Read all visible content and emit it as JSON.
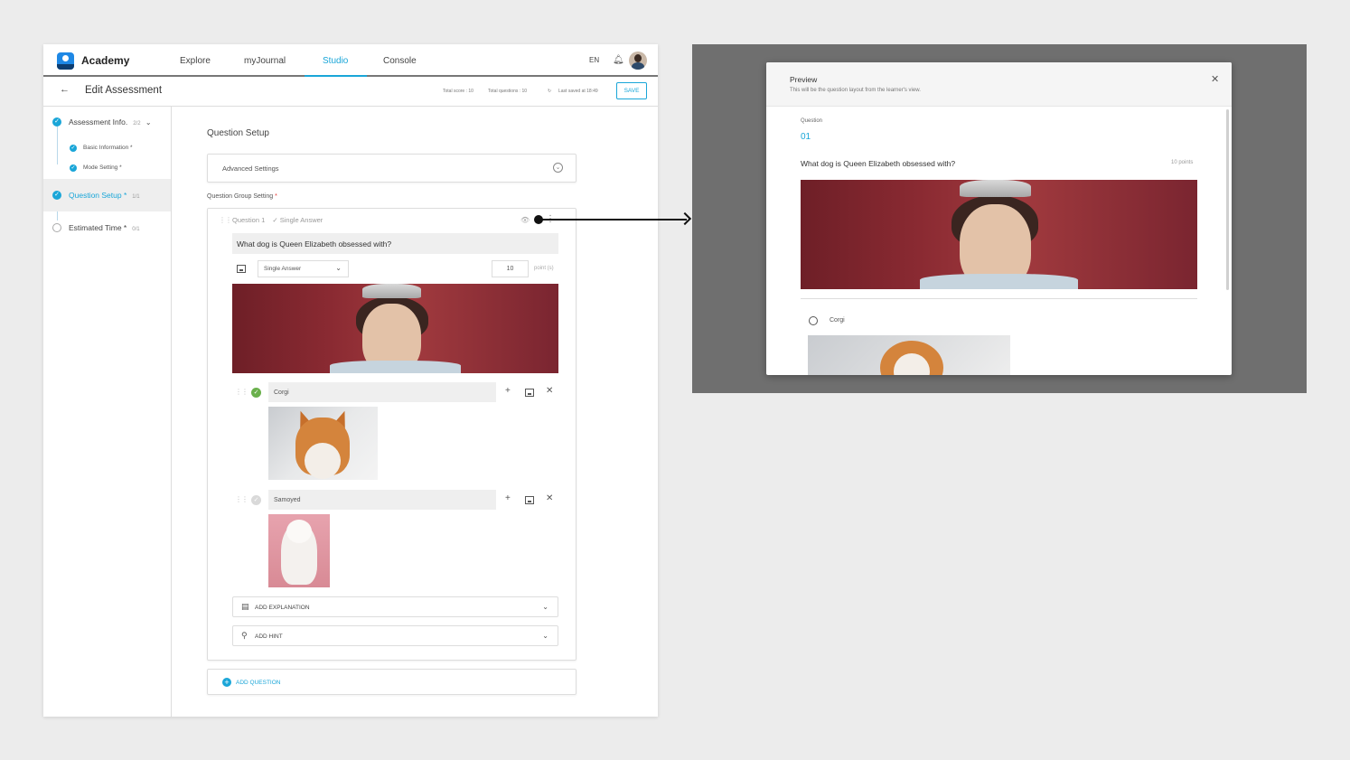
{
  "app": {
    "brand": "Academy",
    "nav": [
      "Explore",
      "myJournal",
      "Studio",
      "Console"
    ],
    "active_nav": "Studio",
    "lang": "EN"
  },
  "header": {
    "title": "Edit Assessment",
    "total_score": "Total score : 10",
    "total_questions": "Total questions : 10",
    "last_saved": "Last saved at 18:49",
    "save_label": "SAVE"
  },
  "sidebar": {
    "assessment_info": {
      "label": "Assessment Info.",
      "count": "2/2"
    },
    "basic_info": "Basic Information *",
    "mode_setting": "Mode Setting *",
    "question_setup": {
      "label": "Question Setup *",
      "count": "1/1"
    },
    "estimated_time": {
      "label": "Estimated Time *",
      "count": "0/1"
    }
  },
  "main": {
    "section_title": "Question Setup",
    "advanced_settings": "Advanced Settings",
    "group_label": "Question Group Setting",
    "question": {
      "label": "Question 1",
      "type_tag": "Single Answer",
      "text": "What dog is Queen Elizabeth obsessed with?",
      "type_select": "Single Answer",
      "points_value": "10",
      "points_unit": "point (s)"
    },
    "answers": [
      {
        "text": "Corgi",
        "correct": true
      },
      {
        "text": "Samoyed",
        "correct": false
      }
    ],
    "add_explanation": "ADD EXPLANATION",
    "add_hint": "ADD HINT",
    "add_question": "ADD QUESTION"
  },
  "preview": {
    "title": "Preview",
    "subtitle": "This will be the question layout from the learner's view.",
    "question_label": "Question",
    "question_number": "01",
    "question_text": "What dog is Queen Elizabeth obsessed with?",
    "points": "10 points",
    "option": "Corgi"
  },
  "colors": {
    "accent": "#1aa6d8",
    "correct": "#6ab04c",
    "overlay": "#6f6f6f"
  }
}
